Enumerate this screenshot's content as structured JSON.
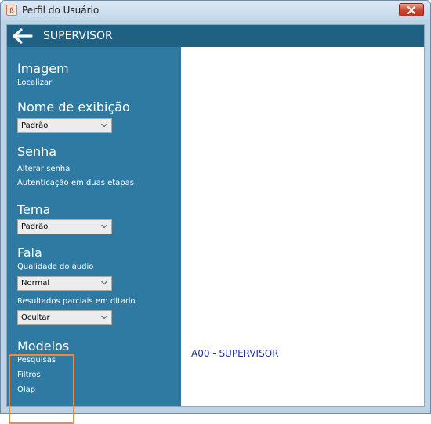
{
  "window": {
    "title": "Perfil do Usuário"
  },
  "header": {
    "title": "SUPERVISOR"
  },
  "sidebar": {
    "imagem": {
      "title": "Imagem",
      "link": "Localizar"
    },
    "nome_exibicao": {
      "title": "Nome de exibição",
      "value": "Padrão"
    },
    "senha": {
      "title": "Senha",
      "links": [
        "Alterar senha",
        "Autenticação em duas etapas"
      ]
    },
    "tema": {
      "title": "Tema",
      "value": "Padrão"
    },
    "fala": {
      "title": "Fala",
      "qualidade_label": "Qualidade do áudio",
      "qualidade_value": "Normal",
      "resultados_label": "Resultados parciais em ditado",
      "resultados_value": "Ocultar"
    },
    "modelos": {
      "title": "Modelos",
      "links": [
        "Pesquisas",
        "Filtros",
        "Olap"
      ]
    }
  },
  "main": {
    "label": "A00 - SUPERVISOR"
  },
  "colors": {
    "header": "#1e6182",
    "sidebar": "#2f7aa2",
    "highlight": "#ef8a3c",
    "label": "#1f2f9f"
  },
  "icons": {
    "app": "app-logo-icon",
    "close": "close-icon",
    "back": "arrow-left-icon",
    "chevron": "chevron-down-icon"
  }
}
